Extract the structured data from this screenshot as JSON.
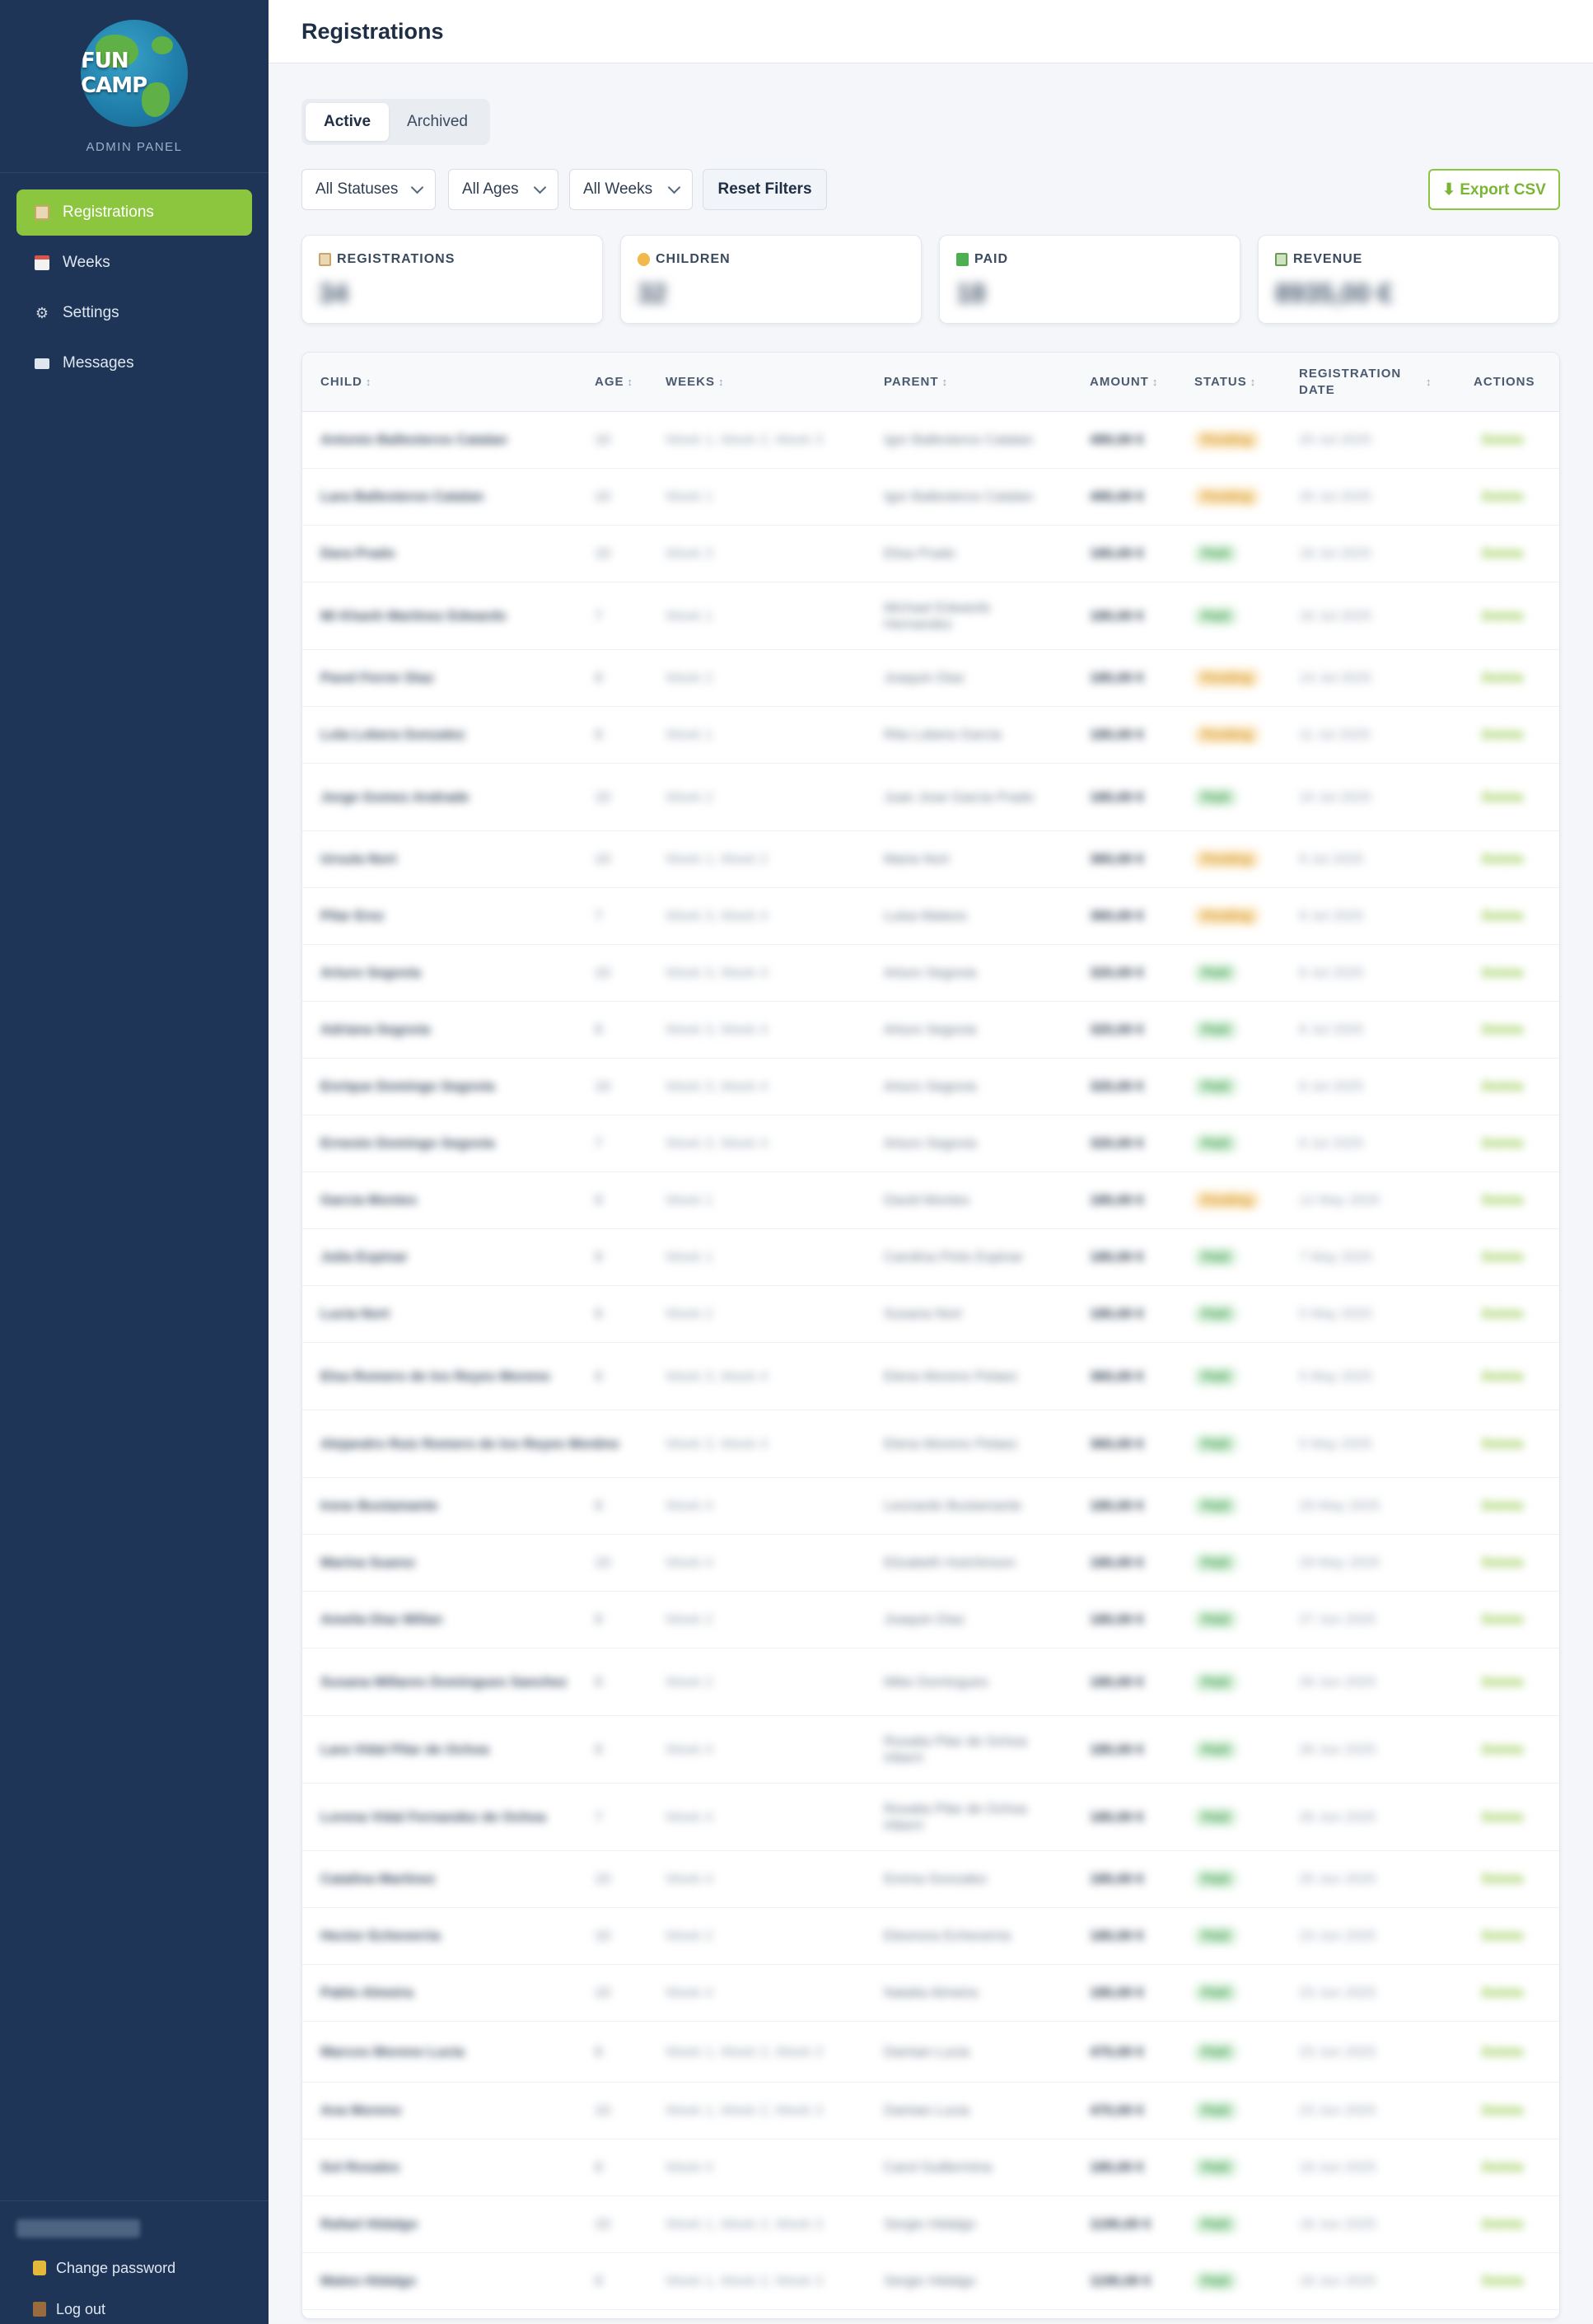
{
  "app": {
    "logo_text": "FUN CAMP",
    "subtitle": "ADMIN PANEL",
    "accent_color": "#8cc63f",
    "sidebar_color": "#1e3557"
  },
  "sidebar": {
    "items": [
      {
        "label": "Registrations",
        "icon": "clipboard-icon",
        "active": true
      },
      {
        "label": "Weeks",
        "icon": "calendar-icon",
        "active": false
      },
      {
        "label": "Settings",
        "icon": "gear-icon",
        "active": false
      },
      {
        "label": "Messages",
        "icon": "mail-icon",
        "active": false
      }
    ],
    "footer": {
      "change_password": "Change password",
      "log_out": "Log out"
    }
  },
  "header": {
    "title": "Registrations"
  },
  "tabs": [
    {
      "label": "Active",
      "active": true
    },
    {
      "label": "Archived",
      "active": false
    }
  ],
  "filters": {
    "status": "All Statuses",
    "ages": "All Ages",
    "weeks": "All Weeks",
    "reset_label": "Reset Filters",
    "export_label": "⬇ Export CSV"
  },
  "stats": [
    {
      "label": "REGISTRATIONS",
      "icon": "clipboard-icon",
      "value": "34"
    },
    {
      "label": "CHILDREN",
      "icon": "child-icon",
      "value": "32"
    },
    {
      "label": "PAID",
      "icon": "check-icon",
      "value": "18"
    },
    {
      "label": "REVENUE",
      "icon": "cash-icon",
      "value": "8935,00 €"
    }
  ],
  "table": {
    "columns": [
      "CHILD",
      "AGE",
      "WEEKS",
      "PARENT",
      "AMOUNT",
      "STATUS",
      "REGISTRATION DATE",
      "ACTIONS"
    ],
    "rows": [
      {
        "child": "Antonio Ballesteros Catalan",
        "age": "10",
        "weeks": "Week 1, Week 2, Week 3",
        "parent": "Igor Ballesteros Catalan",
        "amount": "490,00 €",
        "status": "Pending",
        "date": "20 Jul 2025",
        "action": "Delete"
      },
      {
        "child": "Lara Ballesteros Catalan",
        "age": "10",
        "weeks": "Week 1",
        "parent": "Igor Ballesteros Catalan",
        "amount": "490,00 €",
        "status": "Pending",
        "date": "20 Jul 2025",
        "action": "Delete"
      },
      {
        "child": "Dara Prado",
        "age": "10",
        "weeks": "Week 3",
        "parent": "Elisa Prado",
        "amount": "180,00 €",
        "status": "Paid",
        "date": "18 Jul 2025",
        "action": "Delete"
      },
      {
        "child": "Mi Khanh Martinez Edwards",
        "age": "7",
        "weeks": "Week 1",
        "parent": "Michael Edwards Hernandez",
        "amount": "180,00 €",
        "status": "Paid",
        "date": "16 Jul 2025",
        "action": "Delete"
      },
      {
        "child": "Pavel Ferrer Diaz",
        "age": "8",
        "weeks": "Week 2",
        "parent": "Joaquin Diaz",
        "amount": "180,00 €",
        "status": "Pending",
        "date": "14 Jul 2025",
        "action": "Delete"
      },
      {
        "child": "Lola Lobera Gonzalez",
        "age": "8",
        "weeks": "Week 1",
        "parent": "Rita Lobera Garcia",
        "amount": "180,00 €",
        "status": "Pending",
        "date": "11 Jul 2025",
        "action": "Delete"
      },
      {
        "child": "Jorge Gomez Andrade",
        "age": "10",
        "weeks": "Week 2",
        "parent": "Juan Jose Garcia Prado",
        "amount": "180,00 €",
        "status": "Paid",
        "date": "10 Jul 2025",
        "action": "Delete"
      },
      {
        "child": "Ursula Nort",
        "age": "10",
        "weeks": "Week 1, Week 2",
        "parent": "Maria Nort",
        "amount": "360,00 €",
        "status": "Pending",
        "date": "9 Jul 2025",
        "action": "Delete"
      },
      {
        "child": "Pilar Erez",
        "age": "7",
        "weeks": "Week 3, Week 4",
        "parent": "Luisa Mateos",
        "amount": "360,00 €",
        "status": "Pending",
        "date": "9 Jul 2025",
        "action": "Delete"
      },
      {
        "child": "Arturo Segovia",
        "age": "10",
        "weeks": "Week 3, Week 4",
        "parent": "Arturo Segovia",
        "amount": "320,00 €",
        "status": "Paid",
        "date": "8 Jul 2025",
        "action": "Delete"
      },
      {
        "child": "Adriana Segovia",
        "age": "8",
        "weeks": "Week 3, Week 4",
        "parent": "Arturo Segovia",
        "amount": "320,00 €",
        "status": "Paid",
        "date": "8 Jul 2025",
        "action": "Delete"
      },
      {
        "child": "Enrique Domingo Segovia",
        "age": "10",
        "weeks": "Week 3, Week 4",
        "parent": "Arturo Segovia",
        "amount": "320,00 €",
        "status": "Paid",
        "date": "8 Jul 2025",
        "action": "Delete"
      },
      {
        "child": "Ernesto Domingo Segovia",
        "age": "7",
        "weeks": "Week 3, Week 4",
        "parent": "Arturo Segovia",
        "amount": "320,00 €",
        "status": "Paid",
        "date": "8 Jul 2025",
        "action": "Delete"
      },
      {
        "child": "Garcia Montes",
        "age": "8",
        "weeks": "Week 1",
        "parent": "David Montes",
        "amount": "180,00 €",
        "status": "Pending",
        "date": "12 May 2025",
        "action": "Delete"
      },
      {
        "child": "Julia Espinar",
        "age": "8",
        "weeks": "Week 1",
        "parent": "Carolina Pinto Espinar",
        "amount": "180,00 €",
        "status": "Paid",
        "date": "7 May 2025",
        "action": "Delete"
      },
      {
        "child": "Lucia Nort",
        "age": "8",
        "weeks": "Week 2",
        "parent": "Susana Nort",
        "amount": "180,00 €",
        "status": "Paid",
        "date": "5 May 2025",
        "action": "Delete"
      },
      {
        "child": "Elsa Romero de los Reyes Moreno",
        "age": "8",
        "weeks": "Week 3, Week 4",
        "parent": "Elena Moreno Pelaez",
        "amount": "360,00 €",
        "status": "Paid",
        "date": "5 May 2025",
        "action": "Delete"
      },
      {
        "child": "Alejandro Ruiz Romero de los Reyes Moreno",
        "age": "7",
        "weeks": "Week 3, Week 4",
        "parent": "Elena Moreno Pelaez",
        "amount": "360,00 €",
        "status": "Paid",
        "date": "5 May 2025",
        "action": "Delete"
      },
      {
        "child": "Irene Bustamante",
        "age": "8",
        "weeks": "Week 4",
        "parent": "Leonardo Bustamante",
        "amount": "180,00 €",
        "status": "Paid",
        "date": "29 May 2025",
        "action": "Delete"
      },
      {
        "child": "Marina Suarez",
        "age": "10",
        "weeks": "Week 4",
        "parent": "Elizabeth Hutchinson",
        "amount": "180,00 €",
        "status": "Paid",
        "date": "29 May 2025",
        "action": "Delete"
      },
      {
        "child": "Amelia Diaz Millan",
        "age": "8",
        "weeks": "Week 2",
        "parent": "Joaquin Diaz",
        "amount": "180,00 €",
        "status": "Paid",
        "date": "27 Jun 2025",
        "action": "Delete"
      },
      {
        "child": "Susana Millares Domingues Sanchez",
        "age": "8",
        "weeks": "Week 2",
        "parent": "Mike Domingues",
        "amount": "180,00 €",
        "status": "Paid",
        "date": "26 Jun 2025",
        "action": "Delete"
      },
      {
        "child": "Lara Vidal Pilar de Ochoa",
        "age": "8",
        "weeks": "Week 4",
        "parent": "Rosalia Pilar de Ochoa Iriberri",
        "amount": "180,00 €",
        "status": "Paid",
        "date": "26 Jun 2025",
        "action": "Delete"
      },
      {
        "child": "Lorena Vidal Fernandez de Ochoa",
        "age": "7",
        "weeks": "Week 4",
        "parent": "Rosalia Pilar de Ochoa Iriberri",
        "amount": "180,00 €",
        "status": "Paid",
        "date": "26 Jun 2025",
        "action": "Delete"
      },
      {
        "child": "Catalina Martinez",
        "age": "10",
        "weeks": "Week 4",
        "parent": "Emma Gonzalez",
        "amount": "180,00 €",
        "status": "Paid",
        "date": "25 Jun 2025",
        "action": "Delete"
      },
      {
        "child": "Hector Echeverria",
        "age": "10",
        "weeks": "Week 2",
        "parent": "Eleonora Echeverria",
        "amount": "180,00 €",
        "status": "Paid",
        "date": "23 Jun 2025",
        "action": "Delete"
      },
      {
        "child": "Pablo Almeira",
        "age": "10",
        "weeks": "Week 4",
        "parent": "Natalia Almeira",
        "amount": "180,00 €",
        "status": "Paid",
        "date": "23 Jun 2025",
        "action": "Delete"
      },
      {
        "child": "Marcos Moreno Lucia",
        "age": "8",
        "weeks": "Week 1, Week 2, Week 3",
        "parent": "Damian Lucia",
        "amount": "470,00 €",
        "status": "Paid",
        "date": "23 Jun 2025",
        "action": "Delete"
      },
      {
        "child": "Ana Moreno",
        "age": "10",
        "weeks": "Week 1, Week 2, Week 3",
        "parent": "Damian Lucia",
        "amount": "470,00 €",
        "status": "Paid",
        "date": "23 Jun 2025",
        "action": "Delete"
      },
      {
        "child": "Sol Rosales",
        "age": "8",
        "weeks": "Week 4",
        "parent": "Carol Guillermina",
        "amount": "180,00 €",
        "status": "Paid",
        "date": "19 Jun 2025",
        "action": "Delete"
      },
      {
        "child": "Rafael Hidalgo",
        "age": "10",
        "weeks": "Week 1, Week 2, Week 3",
        "parent": "Sergio Hidalgo",
        "amount": "1190,00 €",
        "status": "Paid",
        "date": "18 Jun 2025",
        "action": "Delete"
      },
      {
        "child": "Mateo Hidalgo",
        "age": "8",
        "weeks": "Week 1, Week 2, Week 3",
        "parent": "Sergio Hidalgo",
        "amount": "1190,00 €",
        "status": "Paid",
        "date": "18 Jun 2025",
        "action": "Delete"
      }
    ]
  }
}
